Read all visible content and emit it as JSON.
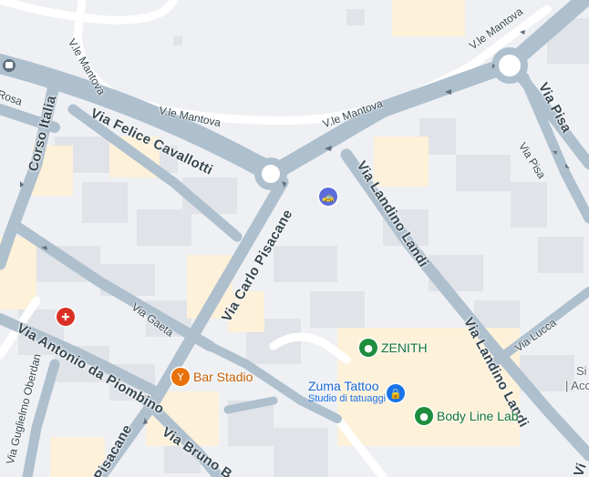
{
  "map": {
    "streets": {
      "viale_mantova_1": "V.le Mantova",
      "viale_mantova_2": "V.le Mantova",
      "viale_mantova_3": "V.le Mantova",
      "viale_mantova_4": "V.le Mantova",
      "via_felice_cavallotti": "Via Felice Cavallotti",
      "corso_italia": "Corso Italia",
      "rosa": "Rosa",
      "via_carlo_pisacane": "Via Carlo Pisacane",
      "pisacane_bottom": "Pisacane",
      "via_landino_landi_1": "Via Landino Landi",
      "via_landino_landi_2": "Via Landino Landi",
      "via_pisa_1": "Via Pisa",
      "via_pisa_2": "Via Pisa",
      "via_gaeta": "Via Gaeta",
      "via_antonio_da_piombino": "Via Antonio da Piombino",
      "via_guglielmo_oberdan": "Via Guglielmo Oberdan",
      "via_bruno_b": "Via Bruno B",
      "via_lucca": "Via Lucca"
    },
    "places": {
      "bar_stadio": {
        "name": "Bar Stadio",
        "icon": "cocktail-icon",
        "color": "#e8710a"
      },
      "zenith": {
        "name": "ZENITH",
        "icon": "shopping-icon",
        "color": "#1e8e3e"
      },
      "zuma_tattoo": {
        "name": "Zuma Tattoo",
        "subtitle": "Studio di tatuaggi",
        "icon": "tattoo-shop-icon",
        "color": "#1a73e8"
      },
      "body_line_lab": {
        "name": "Body Line Lab",
        "icon": "store-icon",
        "color": "#1e8e3e"
      },
      "pharmacy": {
        "icon": "pharmacy-icon",
        "color": "#d93025"
      },
      "taxi": {
        "icon": "taxi-icon",
        "color": "#5b6bd9"
      }
    },
    "edge_text": {
      "partial_1": "Si",
      "partial_2": "| Acc",
      "partial_3": "Vi"
    },
    "colors": {
      "background": "#eef0f3",
      "building": "#e0e3e8",
      "highlight_area": "#fdf1da",
      "road_major": "#aebfce",
      "road_minor": "#ffffff",
      "label_text": "#37474f"
    }
  }
}
